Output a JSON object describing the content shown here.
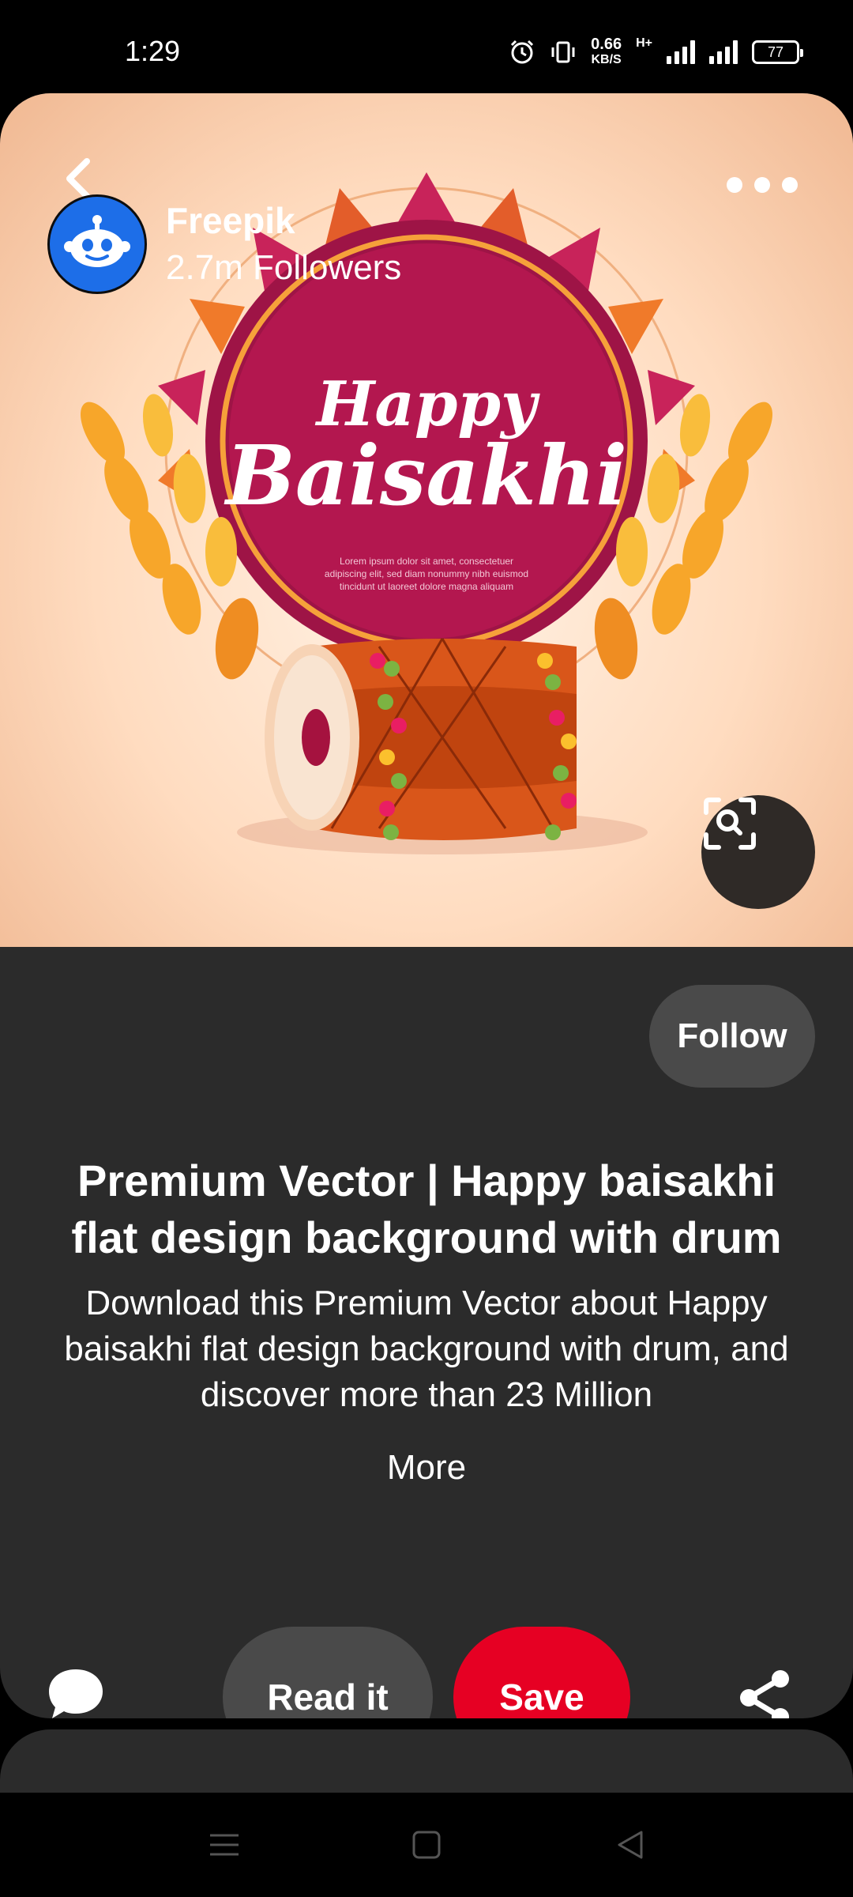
{
  "status_bar": {
    "time": "1:29",
    "net_speed_value": "0.66",
    "net_speed_unit": "KB/S",
    "network_type": "H+",
    "battery": "77"
  },
  "hero_image": {
    "headline_1": "Happy",
    "headline_2": "Baisakhi",
    "lorem_1": "Lorem ipsum dolor sit amet, consectetuer",
    "lorem_2": "adipiscing elit, sed diam nonummy nibh euismod",
    "lorem_3": "tincidunt ut laoreet dolore magna aliquam"
  },
  "creator": {
    "name": "Freepik",
    "followers": "2.7m Followers",
    "follow_label": "Follow"
  },
  "pin": {
    "title": "Premium Vector | Happy baisakhi flat design background with drum",
    "description": "Download this Premium Vector about Happy baisakhi flat design background with drum, and discover more than 23 Million",
    "more_label": "More"
  },
  "actions": {
    "read_label": "Read it",
    "save_label": "Save"
  },
  "colors": {
    "save": "#e60023",
    "card_bg": "#2b2b2b",
    "secondary_button": "#4a4a4a",
    "avatar": "#1d6ee8"
  }
}
